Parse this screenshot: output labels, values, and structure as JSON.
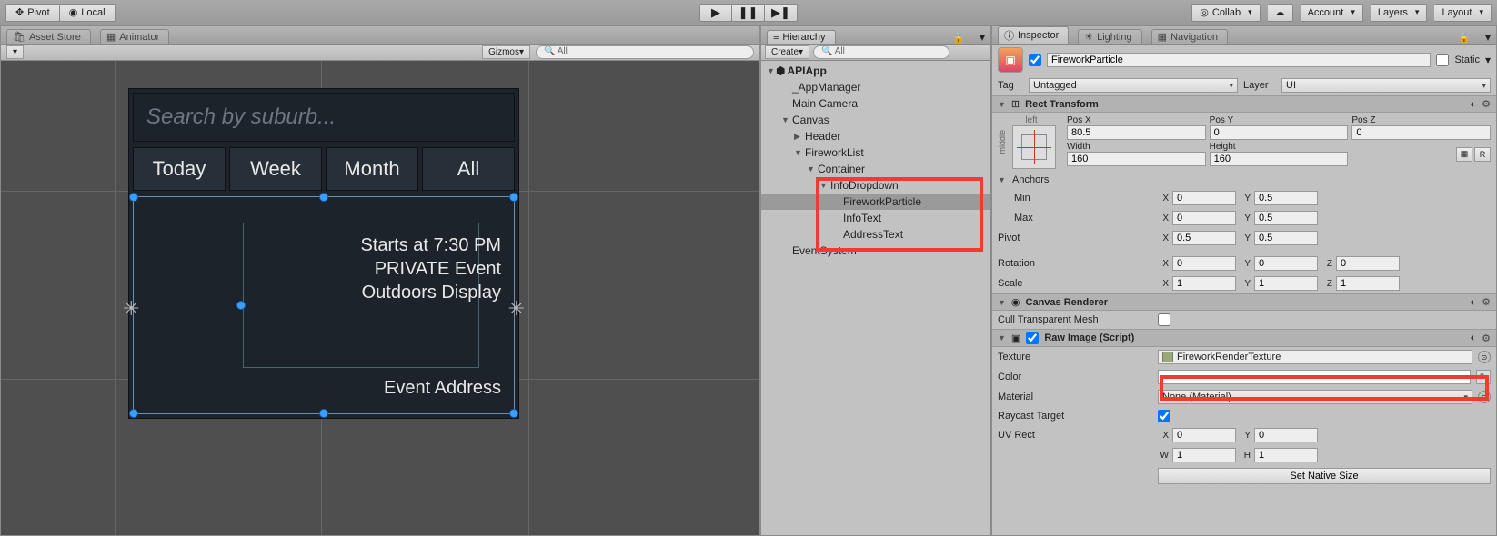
{
  "toolbar": {
    "pivot": "Pivot",
    "local": "Local",
    "collab": "Collab",
    "account": "Account",
    "layers": "Layers",
    "layout": "Layout"
  },
  "scene": {
    "tabs": {
      "assetstore": "Asset Store",
      "animator": "Animator"
    },
    "gizmos": "Gizmos",
    "search_placeholder": "All"
  },
  "app": {
    "search_placeholder": "Search by suburb...",
    "tabs": [
      "Today",
      "Week",
      "Month",
      "All"
    ],
    "event": {
      "line1": "Starts at 7:30 PM",
      "line2": "PRIVATE Event",
      "line3": "Outdoors Display",
      "address": "Event Address"
    }
  },
  "hierarchy": {
    "title": "Hierarchy",
    "create": "Create",
    "search_placeholder": "All",
    "items": {
      "root": "APIApp",
      "appmanager": "_AppManager",
      "maincamera": "Main Camera",
      "canvas": "Canvas",
      "header": "Header",
      "fireworklist": "FireworkList",
      "container": "Container",
      "infodropdown": "InfoDropdown",
      "fireworkparticle": "FireworkParticle",
      "infotext": "InfoText",
      "addresstext": "AddressText",
      "eventsystem": "EventSystem"
    }
  },
  "inspector": {
    "tabs": {
      "inspector": "Inspector",
      "lighting": "Lighting",
      "navigation": "Navigation"
    },
    "obj_name": "FireworkParticle",
    "static": "Static",
    "tag_label": "Tag",
    "tag_value": "Untagged",
    "layer_label": "Layer",
    "layer_value": "UI",
    "rect": {
      "title": "Rect Transform",
      "anchor_h": "left",
      "anchor_v": "middle",
      "posx_l": "Pos X",
      "posx": "80.5",
      "posy_l": "Pos Y",
      "posy": "0",
      "posz_l": "Pos Z",
      "posz": "0",
      "width_l": "Width",
      "width": "160",
      "height_l": "Height",
      "height": "160",
      "anchors": "Anchors",
      "min": "Min",
      "min_x": "0",
      "min_y": "0.5",
      "max": "Max",
      "max_x": "0",
      "max_y": "0.5",
      "pivot": "Pivot",
      "pivot_x": "0.5",
      "pivot_y": "0.5",
      "rotation": "Rotation",
      "rot_x": "0",
      "rot_y": "0",
      "rot_z": "0",
      "scale": "Scale",
      "scl_x": "1",
      "scl_y": "1",
      "scl_z": "1",
      "r_btn": "R"
    },
    "canvasrenderer": {
      "title": "Canvas Renderer",
      "cull": "Cull Transparent Mesh"
    },
    "rawimage": {
      "title": "Raw Image (Script)",
      "texture_l": "Texture",
      "texture": "FireworkRenderTexture",
      "color_l": "Color",
      "material_l": "Material",
      "material": "None (Material)",
      "raycast_l": "Raycast Target",
      "uvrect_l": "UV Rect",
      "uv_x": "0",
      "uv_y": "0",
      "uv_w": "1",
      "uv_h": "1",
      "setnative": "Set Native Size"
    }
  }
}
